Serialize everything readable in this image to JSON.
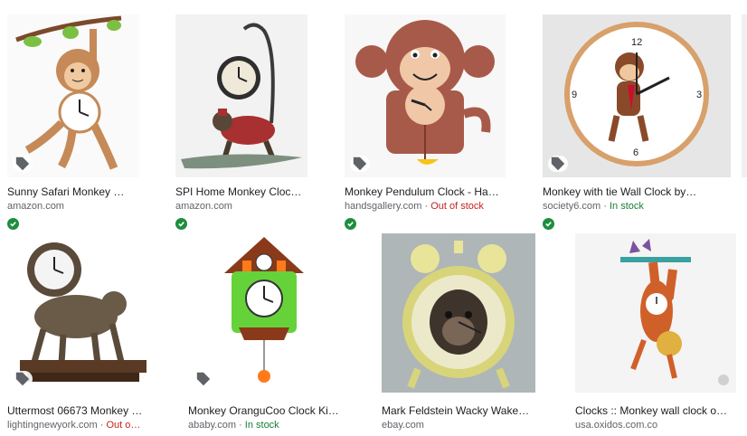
{
  "results": [
    {
      "title": "Sunny Safari Monkey …",
      "source": "amazon.com",
      "verified": true
    },
    {
      "title": "SPI Home Monkey Cloc…",
      "source": "amazon.com",
      "verified": true
    },
    {
      "title": "Monkey Pendulum Clock - Ha…",
      "source": "handsgallery.com",
      "sep": " · ",
      "status": "Out of stock",
      "verified": true
    },
    {
      "title": "Monkey with tie Wall Clock by…",
      "source": "society6.com",
      "sep": " · ",
      "status": "In stock",
      "verified": true
    },
    {
      "title": "Uttermost 06673 Monkey …",
      "source": "lightingnewyork.com",
      "sep": " · ",
      "status": "Out o…"
    },
    {
      "title": "Monkey OranguCoo Clock Ki…",
      "source": "ababy.com",
      "sep": " · ",
      "status": "In stock"
    },
    {
      "title": "Mark Feldstein Wacky Wake…",
      "source": "ebay.com"
    },
    {
      "title": "Clocks :: Monkey wall clock o…",
      "source": "usa.oxidos.com.co"
    }
  ],
  "colors": {
    "verified": "#1e8e3e",
    "out_of_stock": "#c5221f",
    "in_stock": "#188038"
  }
}
